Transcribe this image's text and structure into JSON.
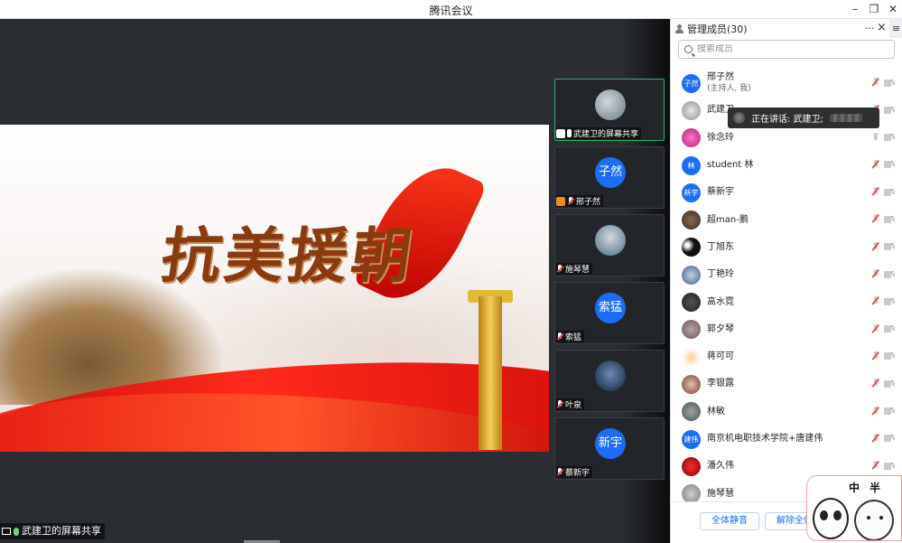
{
  "window": {
    "title": "腾讯会议"
  },
  "share": {
    "slide_title": "抗美援朝",
    "presenter_label": "武建卫的屏幕共享"
  },
  "thumbnails": [
    {
      "name": "武建卫的屏幕共享",
      "type": "photo",
      "avatar_text": ""
    },
    {
      "name": "邢子然",
      "type": "avatar",
      "avatar_text": "子然"
    },
    {
      "name": "施琴慧",
      "type": "photo",
      "avatar_text": ""
    },
    {
      "name": "索猛",
      "type": "avatar",
      "avatar_text": "索猛"
    },
    {
      "name": "叶泉",
      "type": "photo",
      "avatar_text": ""
    },
    {
      "name": "蔡新宇",
      "type": "avatar",
      "avatar_text": "新宇"
    }
  ],
  "panel": {
    "title": "管理成员(30)",
    "more_label": "···",
    "close_label": "×",
    "collapse_label": "≡",
    "search_placeholder": "搜索成员",
    "speaking_tooltip": "正在讲话: 武建卫;",
    "members": [
      {
        "avatar": "子然",
        "name": "邢子然",
        "sub": "(主持人, 我)"
      },
      {
        "avatar": "",
        "name": "武建卫",
        "sub": ""
      },
      {
        "avatar": "",
        "name": "徐念玲",
        "sub": ""
      },
      {
        "avatar": "林",
        "name": "student 林",
        "sub": ""
      },
      {
        "avatar": "新宇",
        "name": "蔡新宇",
        "sub": ""
      },
      {
        "avatar": "",
        "name": "超man-鹏",
        "sub": ""
      },
      {
        "avatar": "",
        "name": "丁旭东",
        "sub": ""
      },
      {
        "avatar": "",
        "name": "丁艳玲",
        "sub": ""
      },
      {
        "avatar": "",
        "name": "高水霓",
        "sub": ""
      },
      {
        "avatar": "",
        "name": "郭夕琴",
        "sub": ""
      },
      {
        "avatar": "",
        "name": "蒋可可",
        "sub": ""
      },
      {
        "avatar": "",
        "name": "李银露",
        "sub": ""
      },
      {
        "avatar": "",
        "name": "林敏",
        "sub": ""
      },
      {
        "avatar": "建伟",
        "name": "南京机电职技术学院+唐建伟",
        "sub": ""
      },
      {
        "avatar": "",
        "name": "潘久伟",
        "sub": ""
      },
      {
        "avatar": "",
        "name": "施琴慧",
        "sub": ""
      }
    ],
    "mute_all_label": "全体静音",
    "unmute_all_label": "解除全体静"
  },
  "sticker": {
    "left_char": "中",
    "right_char": "半"
  }
}
